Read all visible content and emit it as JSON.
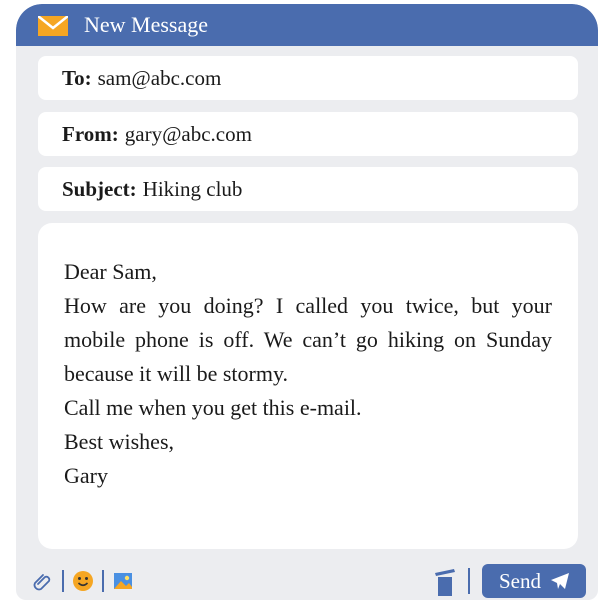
{
  "window": {
    "title": "New Message",
    "accent": "#4a6cae",
    "background": "#ecedf0"
  },
  "fields": {
    "to": {
      "label": "To:",
      "value": "sam@abc.com"
    },
    "from": {
      "label": "From:",
      "value": "gary@abc.com"
    },
    "subject": {
      "label": "Subject:",
      "value": "Hiking club"
    }
  },
  "body": {
    "greeting": "Dear Sam,",
    "paragraph": "How are you doing? I called you twice, but your mobile phone is off. We can’t go hiking on Sunday because it will be stormy.",
    "line": "Call me when you get this e-mail.",
    "closing": "Best wishes,",
    "signature": "Gary"
  },
  "toolbar": {
    "icons": [
      "paperclip-icon",
      "emoji-icon",
      "image-icon",
      "trash-icon"
    ],
    "send_label": "Send"
  }
}
